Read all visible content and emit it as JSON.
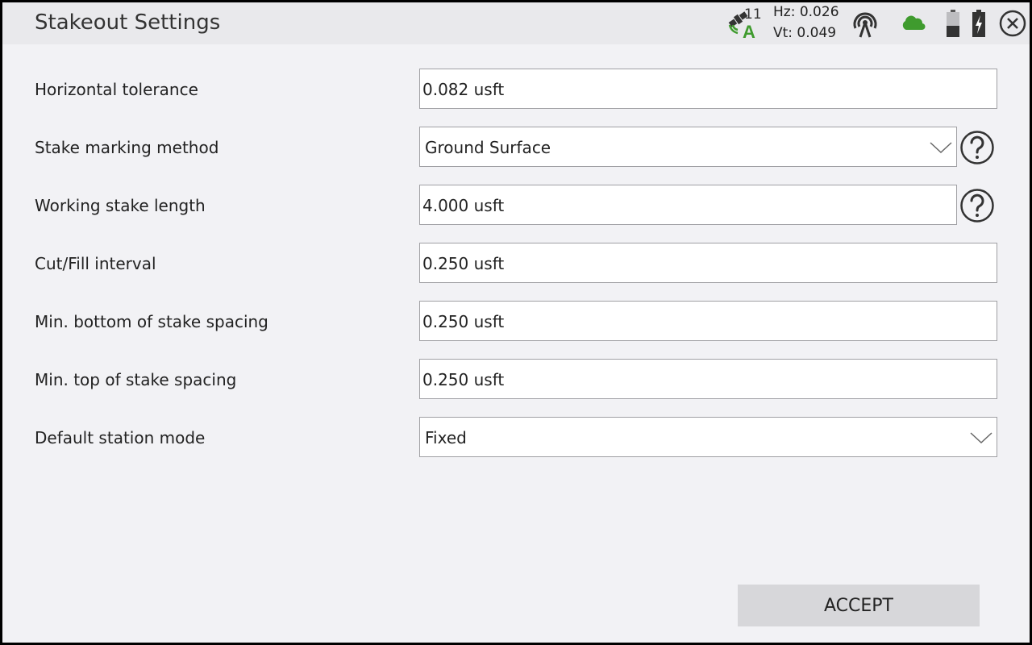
{
  "header": {
    "title": "Stakeout Settings",
    "satellite_count": "11",
    "hz": "Hz: 0.026",
    "vt": "Vt: 0.049",
    "icons": [
      "satellite-icon",
      "radio-icon",
      "cloud-icon",
      "battery-icon",
      "battery-charging-icon",
      "close-icon"
    ],
    "cloud_color": "#3f9b2e"
  },
  "settings": [
    {
      "label": "Horizontal tolerance",
      "value": "0.082 usft",
      "type": "input"
    },
    {
      "label": "Stake marking method",
      "value": "Ground Surface",
      "type": "select"
    },
    {
      "label": "Working stake length",
      "value": "4.000 usft",
      "type": "input"
    },
    {
      "label": "Cut/Fill interval",
      "value": "0.250 usft",
      "type": "input"
    },
    {
      "label": "Min. bottom of stake spacing",
      "value": "0.250 usft",
      "type": "input"
    },
    {
      "label": "Min. top of stake spacing",
      "value": "0.250 usft",
      "type": "input"
    },
    {
      "label": "Default station mode",
      "value": "Fixed",
      "type": "select"
    }
  ],
  "footer": {
    "accept_label": "ACCEPT"
  }
}
